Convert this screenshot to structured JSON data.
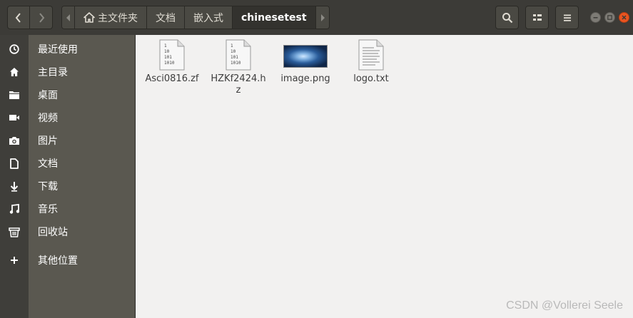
{
  "header": {
    "breadcrumbs": [
      "主文件夹",
      "文档",
      "嵌入式",
      "chinesetest"
    ]
  },
  "sidebar": {
    "items": [
      {
        "label": "最近使用",
        "icon": "clock-icon"
      },
      {
        "label": "主目录",
        "icon": "home-icon"
      },
      {
        "label": "桌面",
        "icon": "folder-icon"
      },
      {
        "label": "视频",
        "icon": "video-icon"
      },
      {
        "label": "图片",
        "icon": "camera-icon"
      },
      {
        "label": "文档",
        "icon": "document-icon"
      },
      {
        "label": "下载",
        "icon": "download-icon"
      },
      {
        "label": "音乐",
        "icon": "music-icon"
      },
      {
        "label": "回收站",
        "icon": "trash-icon"
      },
      {
        "label": "其他位置",
        "icon": "plus-icon"
      }
    ]
  },
  "files": [
    {
      "name": "Asci0816.zf",
      "icon": "binary-file-icon"
    },
    {
      "name": "HZKf2424.hz",
      "icon": "binary-file-icon"
    },
    {
      "name": "image.png",
      "icon": "image-thumbnail"
    },
    {
      "name": "logo.txt",
      "icon": "text-file-icon"
    }
  ],
  "binary_icon_text": [
    "1",
    "10",
    "101",
    "1010"
  ],
  "watermark": "CSDN @Vollerei Seele",
  "colors": {
    "header_bg": "#3c3b37",
    "sidebar_bg": "#5a5850",
    "content_bg": "#f2f1f0",
    "close_button": "#e95420"
  }
}
